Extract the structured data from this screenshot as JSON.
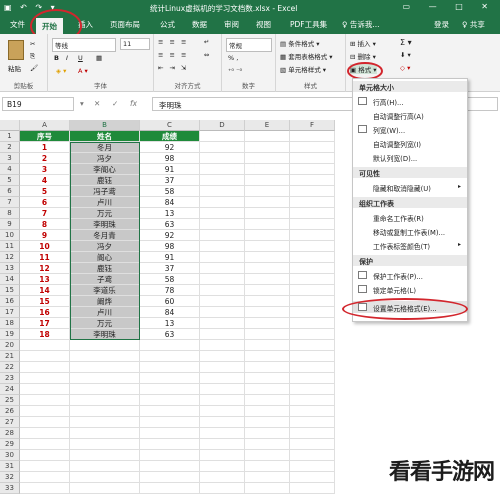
{
  "window": {
    "title": "统计Linux虚拟机的学习文档数.xlsx - Excel",
    "qa": "▣ ↶ ↷ ▾",
    "controls": "▭ — □ ✕"
  },
  "tabs": [
    {
      "label": "文件"
    },
    {
      "label": "开始"
    },
    {
      "label": "插入"
    },
    {
      "label": "页面布局"
    },
    {
      "label": "公式"
    },
    {
      "label": "数据"
    },
    {
      "label": "审阅"
    },
    {
      "label": "视图"
    },
    {
      "label": "PDF工具集"
    },
    {
      "label": "♀ 告诉我..."
    },
    {
      "label": "登录"
    },
    {
      "label": "♀ 共享"
    }
  ],
  "ribbon": {
    "paste": "粘贴",
    "clipboard": "剪贴板",
    "font_name": "等线",
    "font_size": "11",
    "bold": "B",
    "italic": "I",
    "underline": "U",
    "font_group": "字体",
    "align_group": "对齐方式",
    "number_format": "常规",
    "number_group": "数字",
    "cond_format": "条件格式 ▾",
    "table_format": "套用表格格式 ▾",
    "cell_style": "单元格样式 ▾",
    "style_group": "样式",
    "insert": "插入 ▾",
    "delete": "删除 ▾",
    "format": "格式 ▾",
    "sum": "Σ ▾",
    "font_color": "A ▾",
    "fill_color": "◈ ▾",
    "percent": "% ,"
  },
  "formula_bar": {
    "namebox": "B19",
    "cancel": "✕",
    "enter": "✓",
    "fx": "fx",
    "value": "李明珠"
  },
  "columns": [
    "A",
    "B",
    "C",
    "D",
    "E",
    "F"
  ],
  "row_numbers": [
    "1",
    "2",
    "3",
    "4",
    "5",
    "6",
    "7",
    "8",
    "9",
    "10",
    "11",
    "12",
    "13",
    "14",
    "15",
    "16",
    "17",
    "18",
    "19",
    "20",
    "21",
    "22",
    "23",
    "24",
    "25",
    "26",
    "27",
    "28",
    "29",
    "30",
    "31",
    "32",
    "33"
  ],
  "table": {
    "headers": [
      "序号",
      "姓名",
      "成绩"
    ],
    "rows": [
      [
        "1",
        "冬月",
        "92"
      ],
      [
        "2",
        "冯夕",
        "98"
      ],
      [
        "3",
        "李阁心",
        "91"
      ],
      [
        "4",
        "鹿钰",
        "37"
      ],
      [
        "5",
        "冯子鸢",
        "58"
      ],
      [
        "6",
        "卢川",
        "84"
      ],
      [
        "7",
        "万元",
        "13"
      ],
      [
        "8",
        "李明珠",
        "63"
      ],
      [
        "9",
        "冬月青",
        "92"
      ],
      [
        "10",
        "冯夕",
        "98"
      ],
      [
        "11",
        "阁心",
        "91"
      ],
      [
        "12",
        "鹿钰",
        "37"
      ],
      [
        "13",
        "子鸢",
        "58"
      ],
      [
        "14",
        "李道乐",
        "78"
      ],
      [
        "15",
        "阚烨",
        "60"
      ],
      [
        "16",
        "卢川",
        "84"
      ],
      [
        "17",
        "万元",
        "13"
      ],
      [
        "18",
        "李明珠",
        "63"
      ]
    ]
  },
  "format_menu": {
    "section_size": "单元格大小",
    "row_height": "行高(H)...",
    "auto_row": "自动调整行高(A)",
    "col_width": "列宽(W)...",
    "auto_col": "自动调整列宽(I)",
    "default_width": "默认列宽(D)...",
    "section_visibility": "可见性",
    "hide_unhide": "隐藏和取消隐藏(U)",
    "section_organize": "组织工作表",
    "rename": "重命名工作表(R)",
    "move_copy": "移动或复制工作表(M)...",
    "tab_color": "工作表标签颜色(T)",
    "section_protect": "保护",
    "protect_sheet": "保护工作表(P)...",
    "lock_cell": "锁定单元格(L)",
    "format_cells": "设置单元格格式(E)..."
  },
  "watermark": "看看手游网",
  "colors": {
    "accent": "#217346",
    "annotation": "#d2262d",
    "header_fill": "#1f8a3a",
    "number_red": "#c00000",
    "selection": "#c8c8c8"
  }
}
